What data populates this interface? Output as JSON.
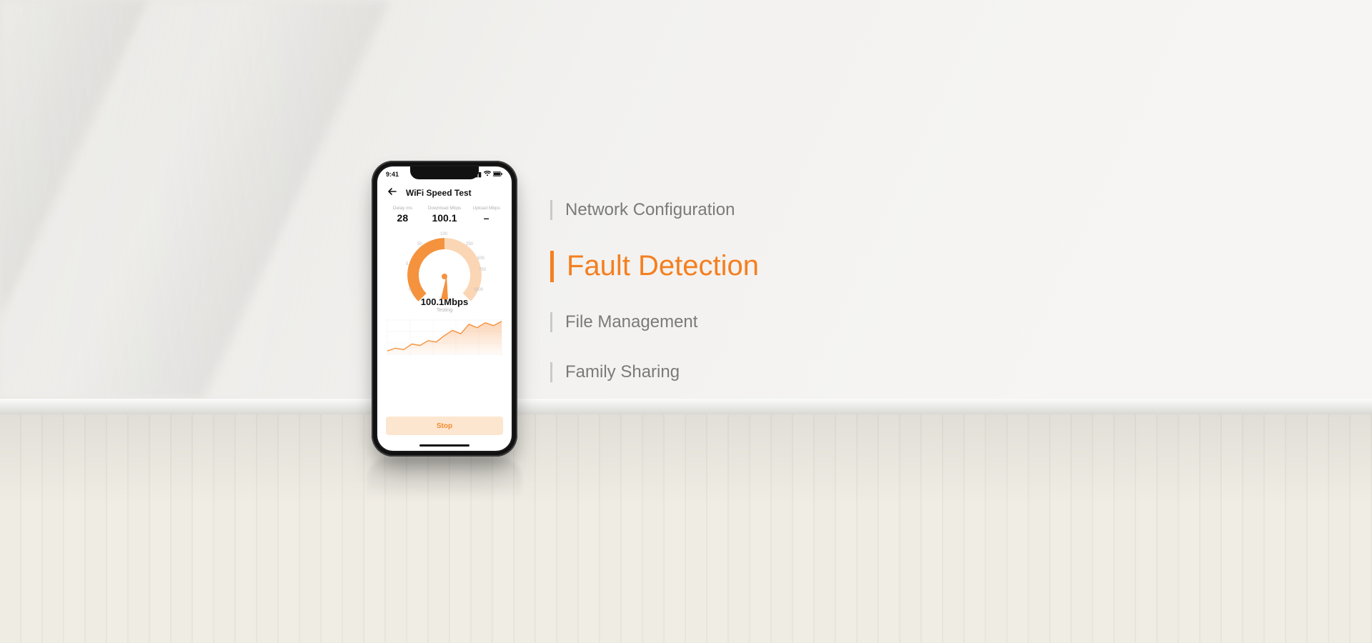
{
  "phone": {
    "status": {
      "time": "9:41"
    },
    "header": {
      "title": "WiFi Speed Test"
    },
    "metrics": {
      "delay": {
        "label": "Delay ms",
        "value": "28"
      },
      "download": {
        "label": "Download Mbps",
        "value": "100.1"
      },
      "upload": {
        "label": "Upload Mbps",
        "value": "–"
      }
    },
    "gauge": {
      "ticks": {
        "t0": "0",
        "t5": "5",
        "t50": "50",
        "t100": "100",
        "t250": "250",
        "t500": "500",
        "t750": "750",
        "t1000": "1000"
      },
      "readout": "100.1Mbps",
      "status": "Testing"
    },
    "stop_label": "Stop"
  },
  "features": {
    "items": [
      {
        "label": "Network Configuration",
        "active": false
      },
      {
        "label": "Fault Detection",
        "active": true
      },
      {
        "label": "File Management",
        "active": false
      },
      {
        "label": "Family Sharing",
        "active": false
      }
    ]
  },
  "colors": {
    "accent": "#f47f20"
  },
  "chart_data": {
    "type": "line",
    "title": "",
    "xlabel": "",
    "ylabel": "",
    "x": [
      0,
      1,
      2,
      3,
      4,
      5,
      6,
      7,
      8,
      9,
      10,
      11,
      12,
      13,
      14
    ],
    "values": [
      10,
      18,
      14,
      30,
      26,
      40,
      36,
      55,
      70,
      60,
      88,
      78,
      92,
      84,
      96
    ],
    "ylim": [
      0,
      100
    ]
  }
}
